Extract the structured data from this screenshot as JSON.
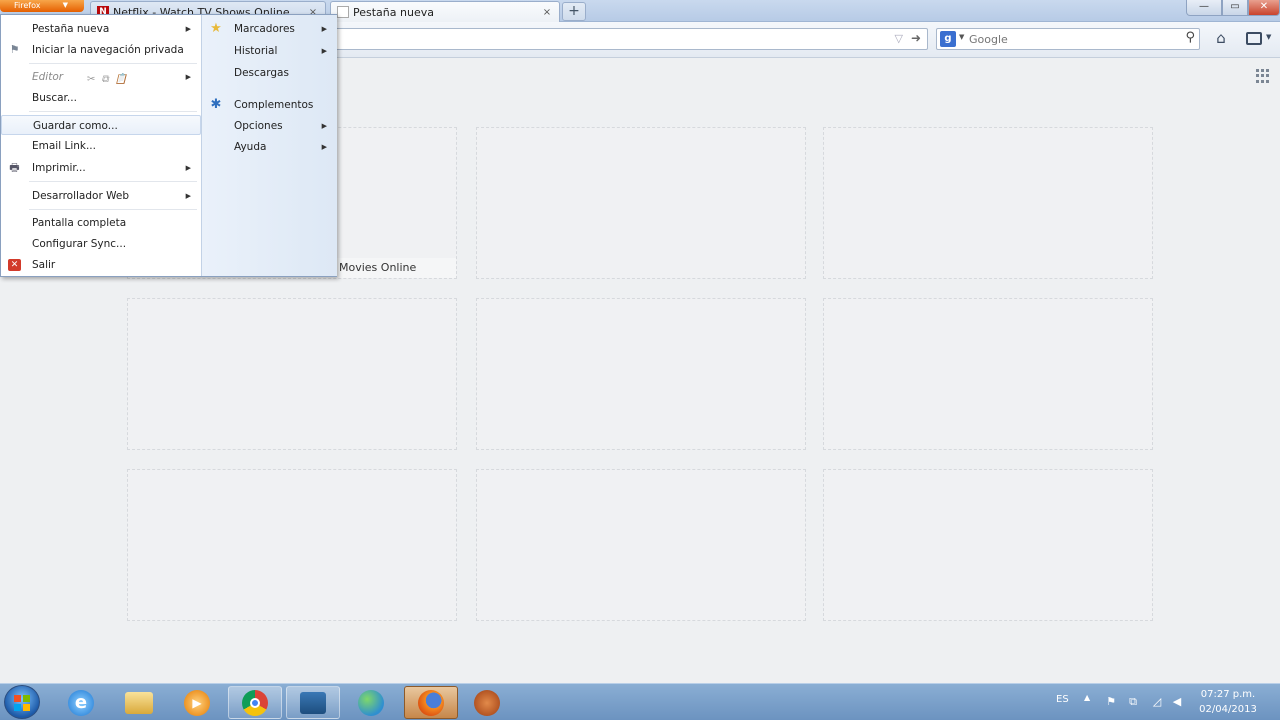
{
  "browser": {
    "firefox_button_label": "Firefox",
    "tabs": [
      {
        "title": "Netflix - Watch TV Shows Online, Wat...",
        "favicon": "netflix-favicon"
      },
      {
        "title": "Pestaña nueva",
        "favicon": "blank-page-favicon"
      }
    ],
    "newtab_label": "+",
    "window_controls": {
      "minimize": "—",
      "maximize": "▭",
      "close": "✕"
    }
  },
  "navbar": {
    "url_value": "",
    "search_placeholder": "Google",
    "search_engine": "google-icon"
  },
  "app_menu": {
    "left": [
      {
        "label": "Pestaña nueva",
        "submenu": true
      },
      {
        "label": "Iniciar la navegación privada",
        "icon": "private-mask-icon"
      },
      {
        "label": "Editor",
        "disabled": true,
        "submenu": true
      },
      {
        "label": "Buscar..."
      },
      {
        "label": "Guardar como..."
      },
      {
        "label": "Email Link..."
      },
      {
        "label": "Imprimir...",
        "submenu": true,
        "icon": "printer-icon"
      },
      {
        "label": "Desarrollador Web",
        "submenu": true
      },
      {
        "label": "Pantalla completa"
      },
      {
        "label": "Configurar Sync..."
      },
      {
        "label": "Salir",
        "icon": "exit-icon"
      }
    ],
    "right": [
      {
        "label": "Marcadores",
        "submenu": true,
        "icon": "star-icon"
      },
      {
        "label": "Historial",
        "submenu": true
      },
      {
        "label": "Descargas"
      },
      {
        "label": "Complementos",
        "icon": "puzzle-icon"
      },
      {
        "label": "Opciones",
        "submenu": true
      },
      {
        "label": "Ayuda",
        "submenu": true
      }
    ],
    "submenu_arrow": "▶",
    "highlighted_item": "Guardar como..."
  },
  "newtab_page": {
    "thumbnails": [
      {
        "title": "Movies Online"
      },
      {
        "title": ""
      },
      {
        "title": ""
      },
      {
        "title": ""
      },
      {
        "title": ""
      },
      {
        "title": ""
      },
      {
        "title": ""
      },
      {
        "title": ""
      },
      {
        "title": ""
      }
    ]
  },
  "taskbar": {
    "apps": [
      {
        "name": "internet-explorer-icon",
        "state": "pinned"
      },
      {
        "name": "file-explorer-icon",
        "state": "pinned"
      },
      {
        "name": "media-player-icon",
        "state": "pinned"
      },
      {
        "name": "chrome-icon",
        "state": "running"
      },
      {
        "name": "app-window-icon",
        "state": "running"
      },
      {
        "name": "network-people-icon",
        "state": "pinned"
      },
      {
        "name": "firefox-icon",
        "state": "active"
      },
      {
        "name": "glove-app-icon",
        "state": "pinned"
      }
    ],
    "tray": {
      "language": "ES",
      "show_hidden": "▲",
      "clock_time": "07:27 p.m.",
      "clock_date": "02/04/2013"
    }
  },
  "colors": {
    "firefox_orange": "#e66000",
    "taskbar_blue": "#6c93c0",
    "tab_strip": "#c9d9ee",
    "menu_highlight": "#e9f0fa"
  }
}
